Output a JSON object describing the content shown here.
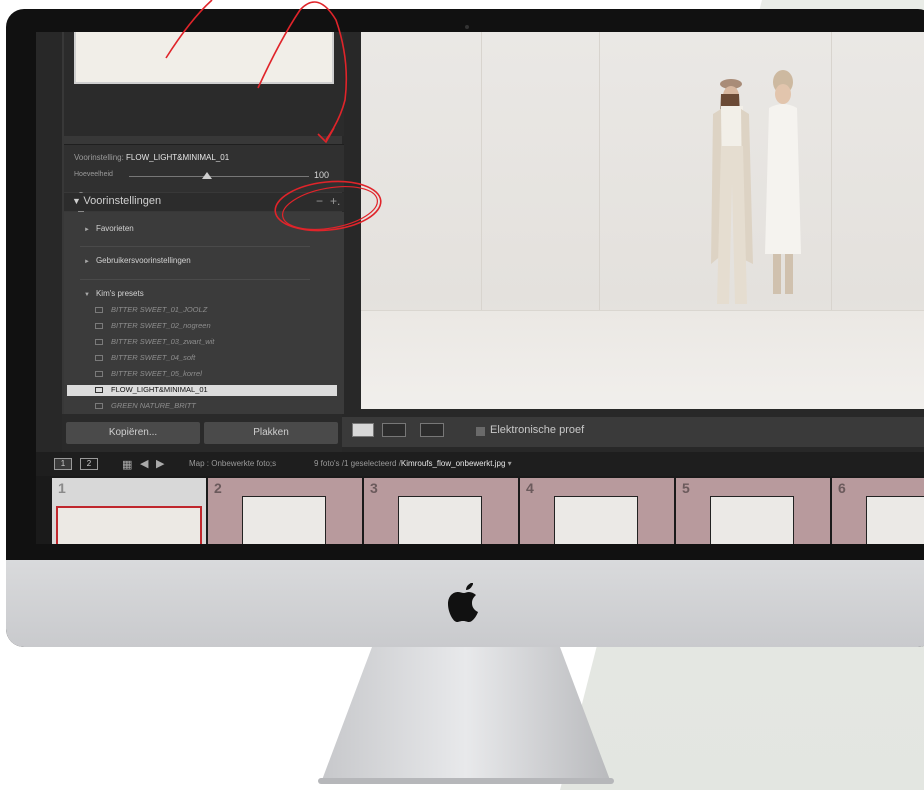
{
  "panel": {
    "preset_label": "Voorinstelling: ",
    "preset_name": "FLOW_LIGHT&MINIMAL_01",
    "amount_label": "Hoeveelheid",
    "amount_value": "100",
    "amount_level": 0.5,
    "presets_title": "Voorinstellingen",
    "minus": "−",
    "plus": "+.",
    "groups": [
      "Favorieten",
      "Gebruikersvoorinstellingen",
      "Kim's presets"
    ],
    "presets": [
      "BITTER SWEET_01_JOOLZ",
      "BITTER SWEET_02_nogreen",
      "BITTER SWEET_03_zwart_wit",
      "BITTER SWEET_04_soft",
      "BITTER SWEET_05_korrel",
      "FLOW_LIGHT&MINIMAL_01",
      "GREEN NATURE_BRITT"
    ],
    "selected_preset": "FLOW_LIGHT&MINIMAL_01",
    "copy_label": "Kopiëren...",
    "paste_label": "Plakken"
  },
  "toolbar": {
    "soft_proof_label": "Elektronische proef"
  },
  "filmstrip": {
    "monitor1": "1",
    "monitor2": "2",
    "path": "Map : Onbewerkte foto;s",
    "count_prefix": "9 foto's /1 geselecteerd /",
    "current_file": "Kimroufs_flow_onbewerkt.jpg",
    "dropdown": "▾",
    "thumbs": [
      "1",
      "2",
      "3",
      "4",
      "5",
      "6"
    ],
    "selected_thumb": "1"
  },
  "colors": {
    "annotation": "#e0242a",
    "thumb_bg": "#b89a9d",
    "selected_border": "#c0272d"
  },
  "icons": {
    "apple": "apple-logo-icon",
    "grid": "grid-view-icon",
    "back": "arrow-left-icon",
    "forward": "arrow-right-icon"
  }
}
